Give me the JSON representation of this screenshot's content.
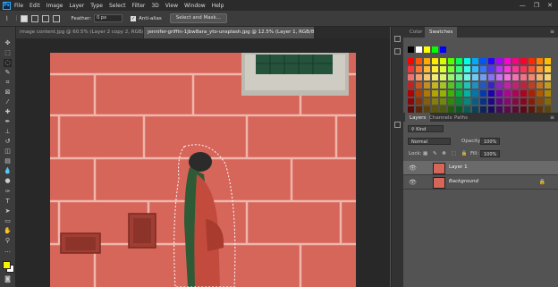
{
  "menu": {
    "logo": "Ps",
    "items": [
      "File",
      "Edit",
      "Image",
      "Layer",
      "Type",
      "Select",
      "Filter",
      "3D",
      "View",
      "Window",
      "Help"
    ],
    "window_controls": [
      "—",
      "❐",
      "✕"
    ]
  },
  "options": {
    "feather_label": "Feather:",
    "feather_value": "0 px",
    "antialias_checked": "✓",
    "antialias_label": "Anti-alias",
    "select_mask_label": "Select and Mask..."
  },
  "tabs": [
    {
      "label": "image content.jpg @ 60.5% (Layer 2 copy 2, RGB/8) *",
      "active": false
    },
    {
      "label": "jennifer-griffin-1jbw8ara_yto-unsplash.jpg @ 12.5% (Layer 1, RGB/8) *",
      "active": true
    }
  ],
  "swatches_panel": {
    "tab_color": "Color",
    "tab_swatches": "Swatches"
  },
  "layers_panel": {
    "tabs": [
      "Layers",
      "Channels",
      "Paths"
    ],
    "kind_label": "Kind",
    "blend_mode": "Normal",
    "opacity_label": "Opacity:",
    "opacity_value": "100%",
    "lock_label": "Lock:",
    "fill_label": "Fill:",
    "fill_value": "100%",
    "layers": [
      {
        "name": "Layer 1",
        "selected": true,
        "italic": false
      },
      {
        "name": "Background",
        "selected": false,
        "italic": true
      }
    ]
  },
  "colors": {
    "foreground": "#f5f500",
    "background": "#ffffff",
    "wall": "#d6655a"
  }
}
